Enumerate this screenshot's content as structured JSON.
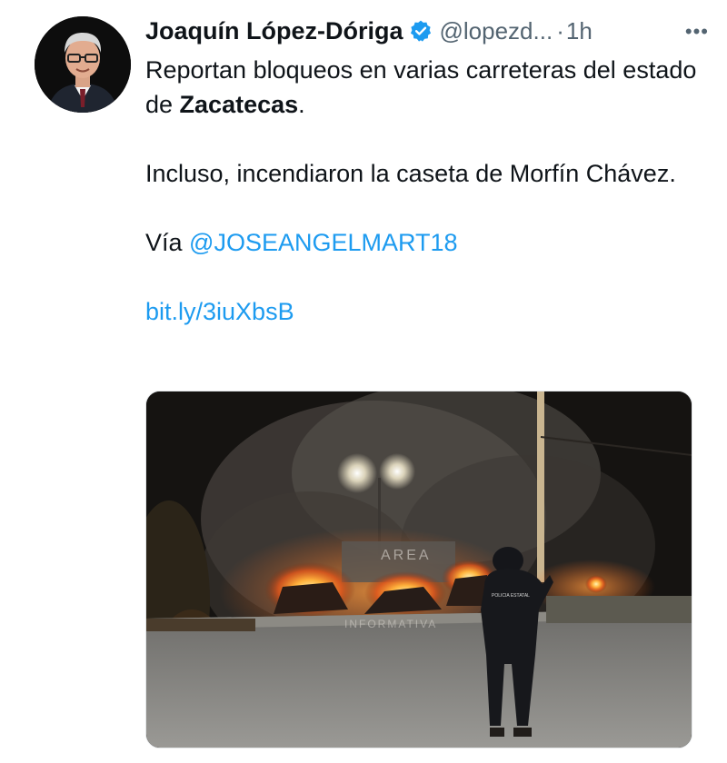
{
  "tweet": {
    "author_name": "Joaquín López-Dóriga",
    "handle": "@lopezd...",
    "separator": "·",
    "time": "1h",
    "more_label": "•••",
    "text_line1a": "Reportan bloqueos en varias carreteras del estado de ",
    "text_line1b": "Zacatecas",
    "text_line1c": ".",
    "text_line2": "Incluso, incendiaron la caseta de Morfín Chávez.",
    "via_label": "Vía ",
    "mention": "@JOSEANGELMART18",
    "link": "bit.ly/3iuXbsB"
  },
  "media": {
    "watermark_top": "AREA",
    "watermark_bottom": "INFORMATIVA",
    "vest_text": "POLICIA ESTATAL"
  },
  "colors": {
    "link": "#1d9bf0",
    "muted": "#536471",
    "verified_badge": "#1d9bf0"
  },
  "icons": {
    "verified": "verified-badge-icon",
    "more": "more-options-icon"
  }
}
